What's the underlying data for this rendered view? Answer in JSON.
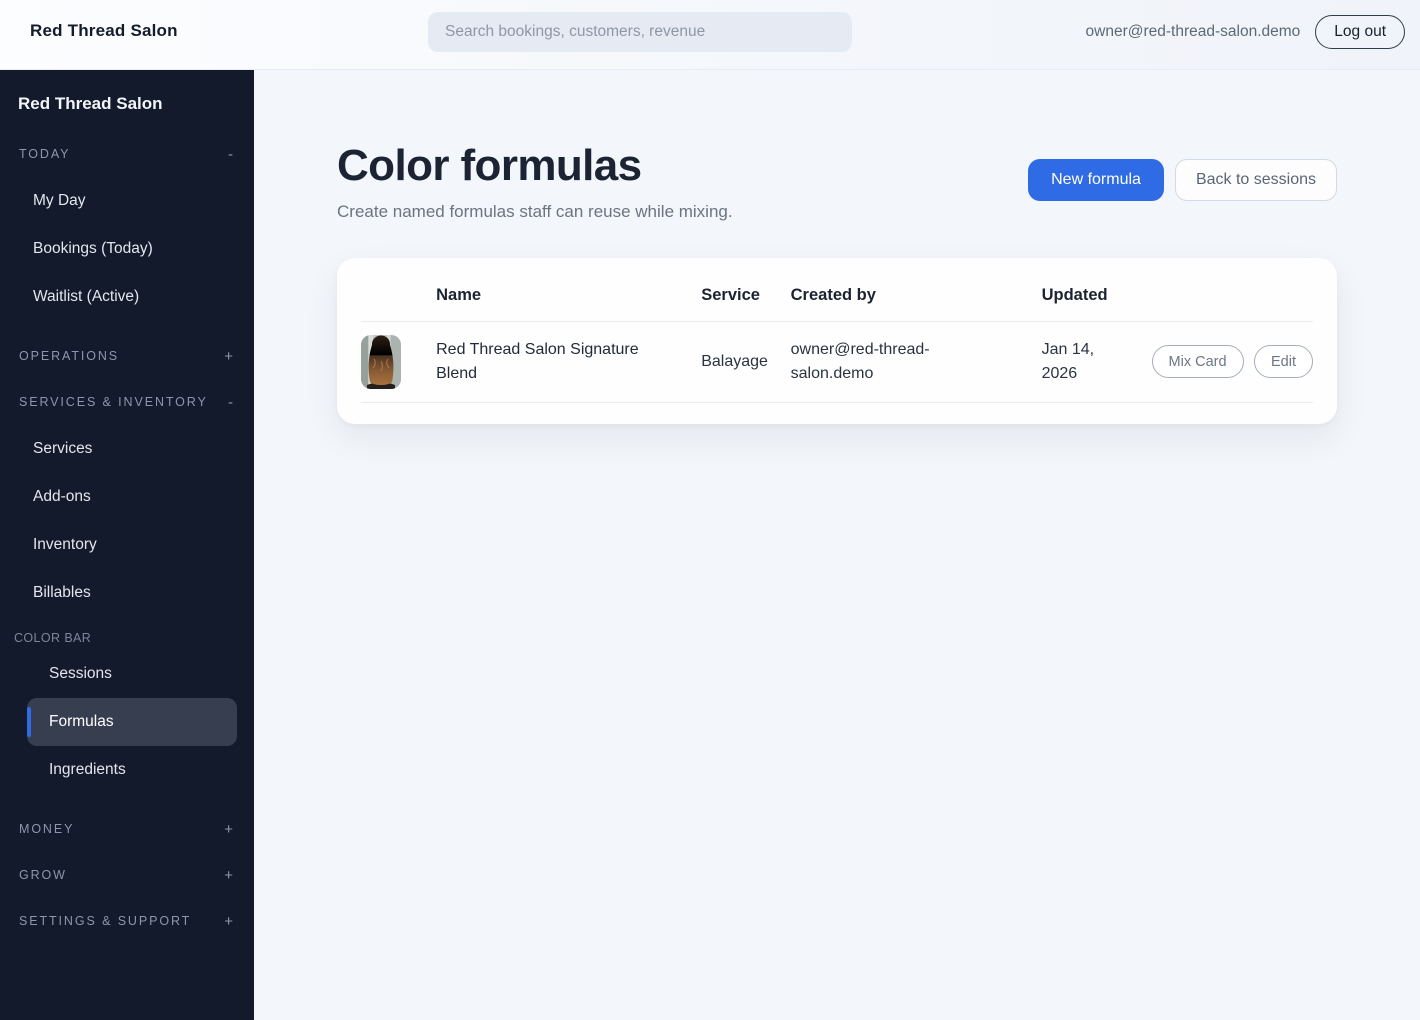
{
  "colors": {
    "accent": "#2e6be5",
    "sidebar_bg": "#121a2c"
  },
  "header": {
    "brand": "Red Thread Salon",
    "search_placeholder": "Search bookings, customers, revenue",
    "user_email": "owner@red-thread-salon.demo",
    "logout_label": "Log out"
  },
  "sidebar": {
    "title": "Red Thread Salon",
    "groups": [
      {
        "label": "TODAY",
        "toggle": "-",
        "items": [
          "My Day",
          "Bookings (Today)",
          "Waitlist (Active)"
        ]
      },
      {
        "label": "OPERATIONS",
        "toggle": "+",
        "items": []
      },
      {
        "label": "SERVICES & INVENTORY",
        "toggle": "-",
        "items": [
          "Services",
          "Add-ons",
          "Inventory",
          "Billables"
        ]
      },
      {
        "label": "MONEY",
        "toggle": "+",
        "items": []
      },
      {
        "label": "GROW",
        "toggle": "+",
        "items": []
      },
      {
        "label": "SETTINGS & SUPPORT",
        "toggle": "+",
        "items": []
      }
    ],
    "colorbar": {
      "label": "COLOR BAR",
      "items": [
        "Sessions",
        "Formulas",
        "Ingredients"
      ],
      "active_item": "Formulas"
    }
  },
  "page": {
    "title": "Color formulas",
    "subtitle": "Create named formulas staff can reuse while mixing.",
    "primary_action": "New formula",
    "secondary_action": "Back to sessions"
  },
  "table": {
    "columns": [
      "Name",
      "Service",
      "Created by",
      "Updated"
    ],
    "rows": [
      {
        "thumbnail": "hair-balayage-photo",
        "name": "Red Thread Salon Signature Blend",
        "service": "Balayage",
        "created_by": "owner@red-thread-salon.demo",
        "updated": "Jan 14, 2026",
        "actions": [
          "Mix Card",
          "Edit"
        ]
      }
    ]
  }
}
